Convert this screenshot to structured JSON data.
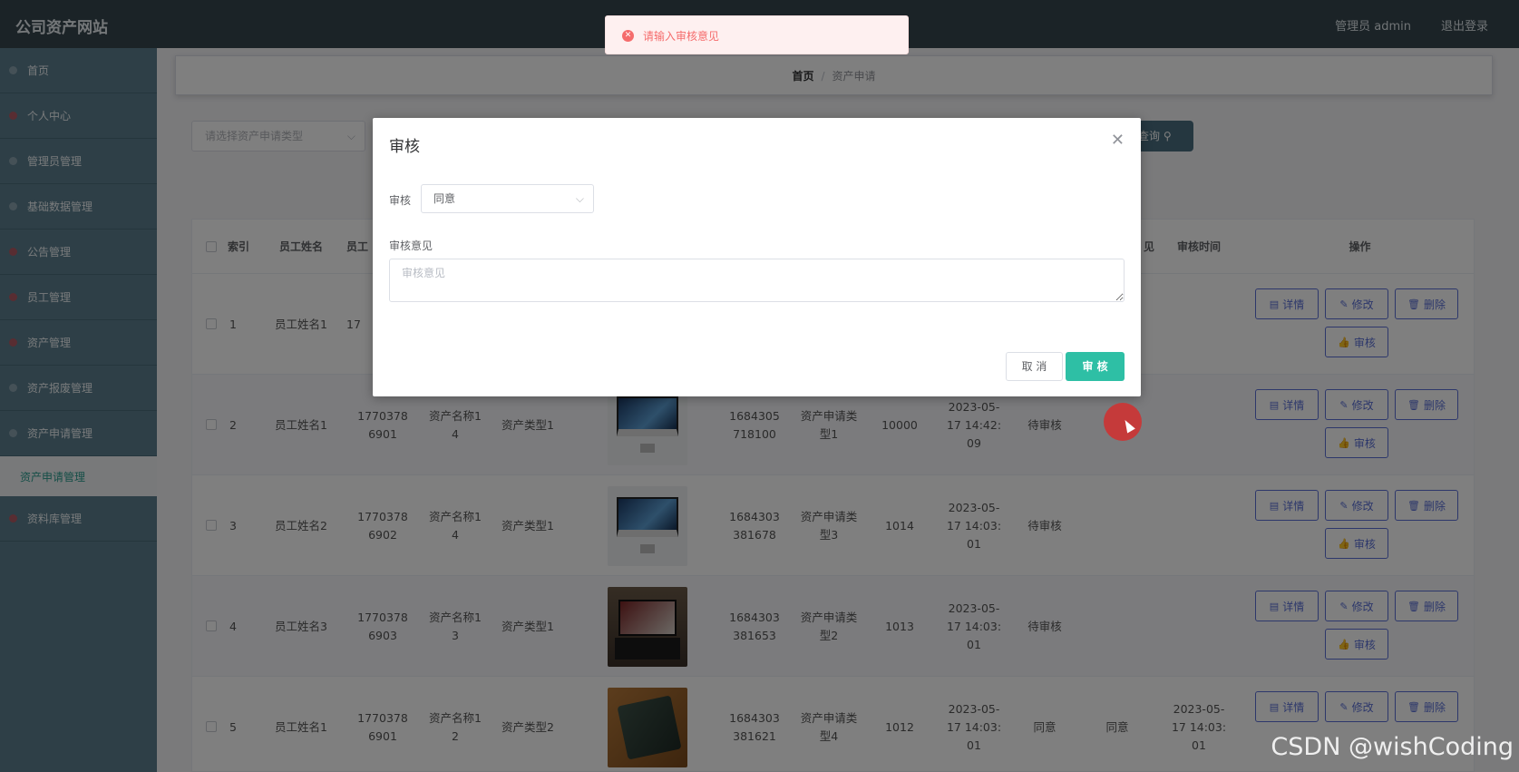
{
  "app": {
    "brand": "公司资产网站",
    "admin_label": "管理员 admin",
    "logout_label": "退出登录"
  },
  "sidebar": {
    "items": [
      {
        "label": "首页"
      },
      {
        "label": "个人中心"
      },
      {
        "label": "管理员管理"
      },
      {
        "label": "基础数据管理"
      },
      {
        "label": "公告管理"
      },
      {
        "label": "员工管理"
      },
      {
        "label": "资产管理"
      },
      {
        "label": "资产报废管理"
      },
      {
        "label": "资产申请管理"
      }
    ],
    "active_sub": "资产申请管理",
    "last_item": "资料库管理"
  },
  "breadcrumb": {
    "home": "首页",
    "separator": "/",
    "current": "资产申请"
  },
  "search": {
    "type_placeholder": "请选择资产申请类型",
    "query_label": "查询"
  },
  "table": {
    "headers": {
      "index": "索引",
      "employee_name": "员工姓名",
      "employee_phone_partial": "员工",
      "review_opinion_partial": "见",
      "review_time": "审核时间",
      "actions": "操作"
    },
    "rows": [
      {
        "index": "1",
        "employee_name": "员工姓名1",
        "phone_partial": "17"
      },
      {
        "index": "2",
        "employee_name": "员工姓名1",
        "phone": "17703786901",
        "asset_name": "资产名称14",
        "asset_type": "资产类型1",
        "image": "imac",
        "apply_no": "1684305718100",
        "apply_type": "资产申请类型1",
        "quantity": "10000",
        "apply_time": "2023-05-17 14:42:09",
        "status": "待审核",
        "opinion": "",
        "review_time": ""
      },
      {
        "index": "3",
        "employee_name": "员工姓名2",
        "phone": "17703786902",
        "asset_name": "资产名称14",
        "asset_type": "资产类型1",
        "image": "imac",
        "apply_no": "1684303381678",
        "apply_type": "资产申请类型3",
        "quantity": "1014",
        "apply_time": "2023-05-17 14:03:01",
        "status": "待审核",
        "opinion": "",
        "review_time": ""
      },
      {
        "index": "4",
        "employee_name": "员工姓名3",
        "phone": "17703786903",
        "asset_name": "资产名称13",
        "asset_type": "资产类型1",
        "image": "laptop",
        "apply_no": "1684303381653",
        "apply_type": "资产申请类型2",
        "quantity": "1013",
        "apply_time": "2023-05-17 14:03:01",
        "status": "待审核",
        "opinion": "",
        "review_time": ""
      },
      {
        "index": "5",
        "employee_name": "员工姓名1",
        "phone": "17703786901",
        "asset_name": "资产名称12",
        "asset_type": "资产类型2",
        "image": "rog",
        "apply_no": "1684303381621",
        "apply_type": "资产申请类型4",
        "quantity": "1012",
        "apply_time": "2023-05-17 14:03:01",
        "status": "同意",
        "opinion": "同意",
        "review_time": "2023-05-17 14:03:01"
      }
    ],
    "actions": {
      "detail": "详情",
      "edit": "修改",
      "delete": "删除",
      "review": "审核"
    }
  },
  "dialog": {
    "title": "审核",
    "review_label": "审核",
    "review_value": "同意",
    "opinion_label": "审核意见",
    "opinion_placeholder": "审核意见",
    "cancel_label": "取 消",
    "confirm_label": "审 核"
  },
  "toast": {
    "message": "请输入审核意见"
  },
  "watermark": "CSDN @wishCoding"
}
